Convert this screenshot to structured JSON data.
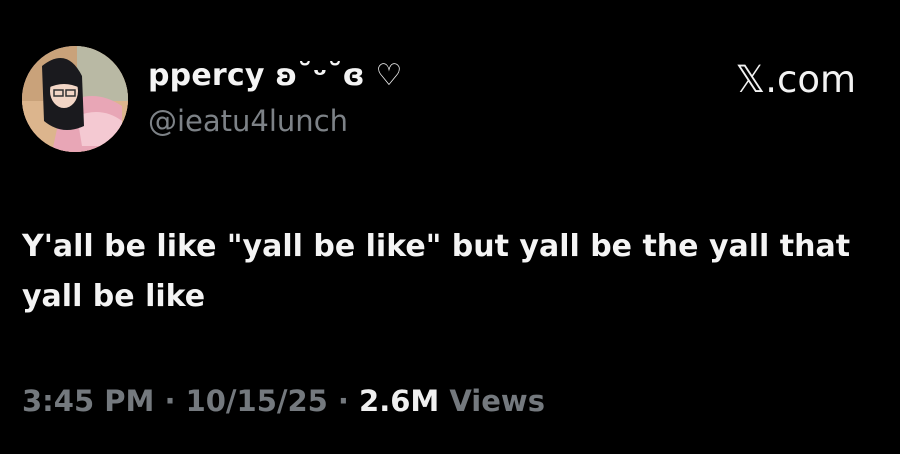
{
  "author": {
    "display_name": "ppercy ʚ˘ᵕ˘ɞ ♡",
    "handle": "@ieatu4lunch"
  },
  "brand": "𝕏.com",
  "tweet": {
    "text": "Y'all be like \"yall be like\" but yall be the yall that yall be like"
  },
  "meta": {
    "time": "3:45 PM",
    "separator1": " · ",
    "date": "10/15/25",
    "separator2": " · ",
    "views_count": "2.6M",
    "views_label": " Views"
  },
  "colors": {
    "background": "#000000",
    "primary_text": "#f4f4f4",
    "secondary_text": "#7d8287"
  }
}
